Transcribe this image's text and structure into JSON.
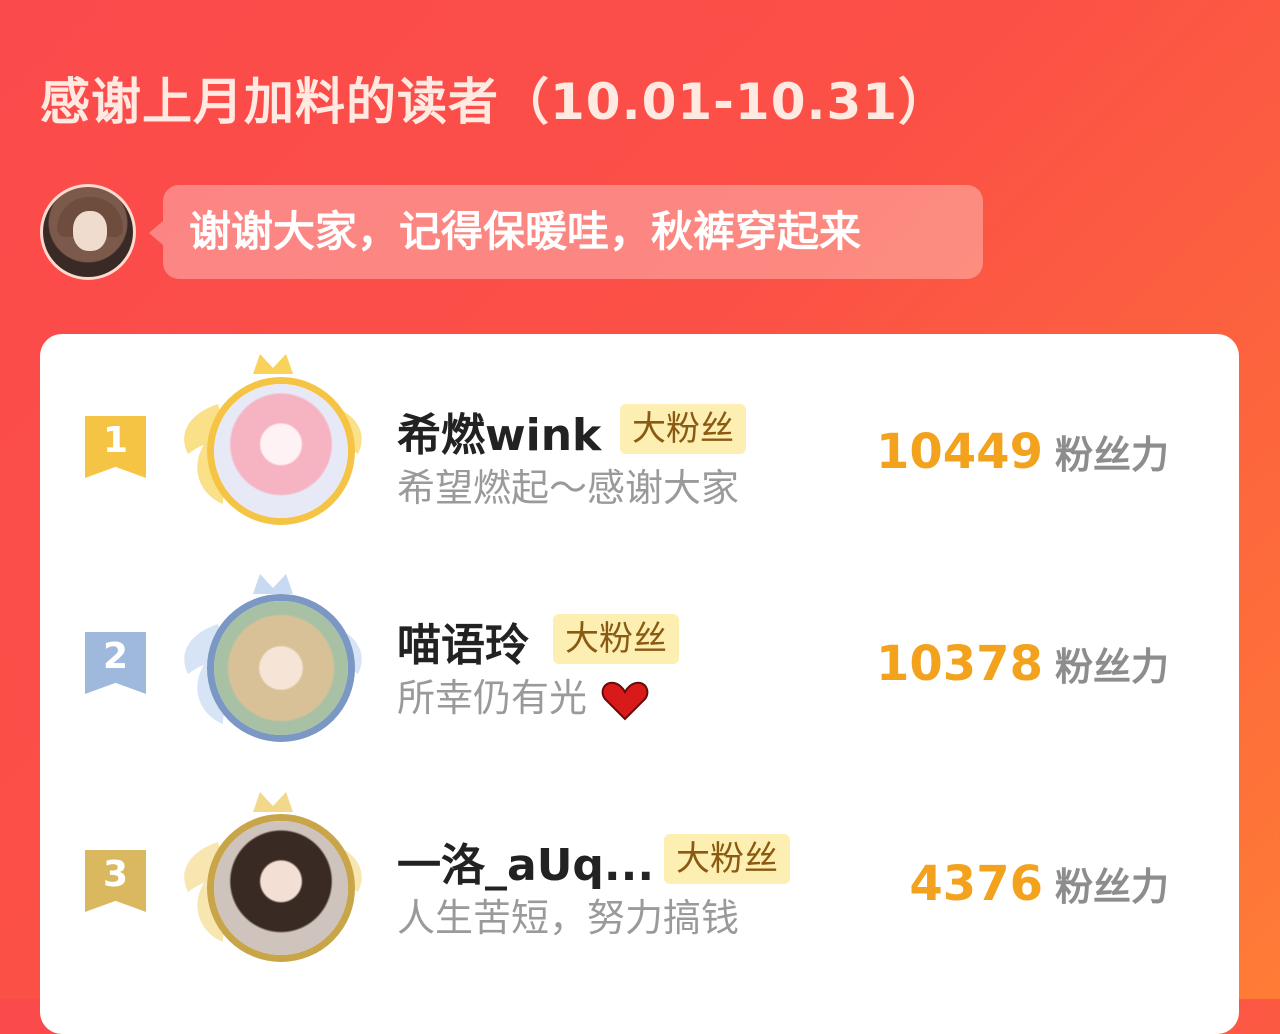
{
  "header": {
    "title": "感谢上月加料的读者（10.01-10.31）",
    "message": "谢谢大家，记得保暖哇，秋裤穿起来"
  },
  "colors": {
    "background": "#fb4a4c",
    "gold": "#f6c445",
    "silver_blue": "#9fb9dc",
    "bronze": "#d9b860",
    "score": "#f3a21e",
    "badge_bg": "#fdeeb2"
  },
  "ranking": [
    {
      "rank": "1",
      "name": "希燃wink",
      "badge": "大粉丝",
      "motto": "希望燃起～感谢大家",
      "score": "10449",
      "unit": "粉丝力"
    },
    {
      "rank": "2",
      "name": "喵语玲",
      "badge": "大粉丝",
      "motto": "所幸仍有光",
      "motto_icon": "heart-icon",
      "score": "10378",
      "unit": "粉丝力"
    },
    {
      "rank": "3",
      "name": "一洛_aUq...",
      "badge": "大粉丝",
      "motto": "人生苦短，努力搞钱",
      "score": "4376",
      "unit": "粉丝力"
    }
  ]
}
